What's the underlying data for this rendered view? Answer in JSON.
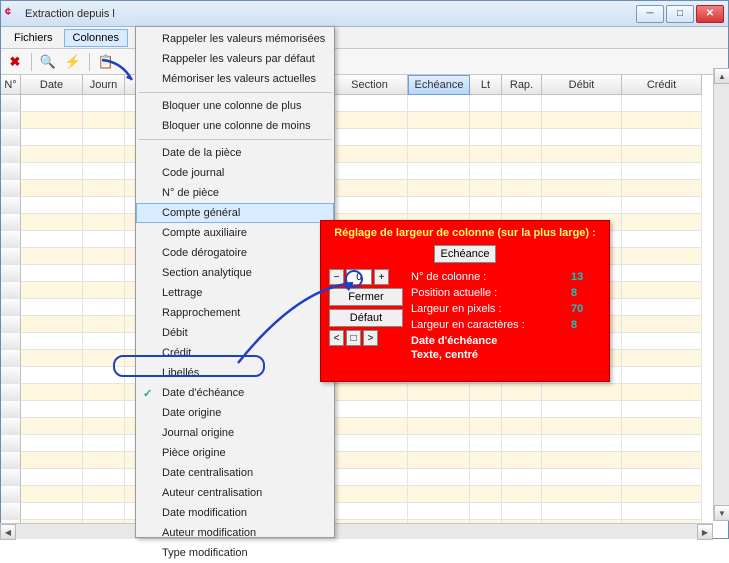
{
  "window": {
    "title": "Extraction depuis l"
  },
  "menubar": {
    "items": [
      "Fichiers",
      "Colonnes"
    ],
    "active_index": 1
  },
  "columns": [
    "N°",
    "Date",
    "Journ",
    "",
    "Section",
    "Echéance",
    "Lt",
    "Rap.",
    "Débit",
    "Crédit"
  ],
  "selected_column_index": 5,
  "dropdown": {
    "groups": [
      [
        "Rappeler les valeurs mémorisées",
        "Rappeler les valeurs par défaut",
        "Mémoriser les valeurs actuelles"
      ],
      [
        "Bloquer une colonne de plus",
        "Bloquer une colonne de moins"
      ],
      [
        "Date de la pièce",
        "Code journal",
        "N° de pièce",
        "Compte général",
        "Compte auxiliaire",
        "Code dérogatoire",
        "Section analytique",
        "Lettrage",
        "Rapprochement",
        "Débit",
        "Crédit",
        "Libellés",
        "Date d'échéance",
        "Date origine",
        "Journal origine",
        "Pièce origine",
        "Date centralisation",
        "Auteur centralisation",
        "Date modification",
        "Auteur modification",
        "Type modification"
      ]
    ],
    "hover": "Compte général",
    "checked": "Date d'échéance"
  },
  "panel": {
    "title": "Réglage de largeur de colonne (sur la plus large) :",
    "column_button": "Echéance",
    "spinner_value": "0",
    "fermer": "Fermer",
    "defaut": "Défaut",
    "rows": [
      {
        "label": "N° de colonne :",
        "value": "13"
      },
      {
        "label": "Position actuelle :",
        "value": "8"
      },
      {
        "label": "Largeur en pixels :",
        "value": "70"
      },
      {
        "label": "Largeur en caractères :",
        "value": "8"
      }
    ],
    "bold_lines": [
      "Date d'échéance",
      "Texte, centré"
    ]
  }
}
